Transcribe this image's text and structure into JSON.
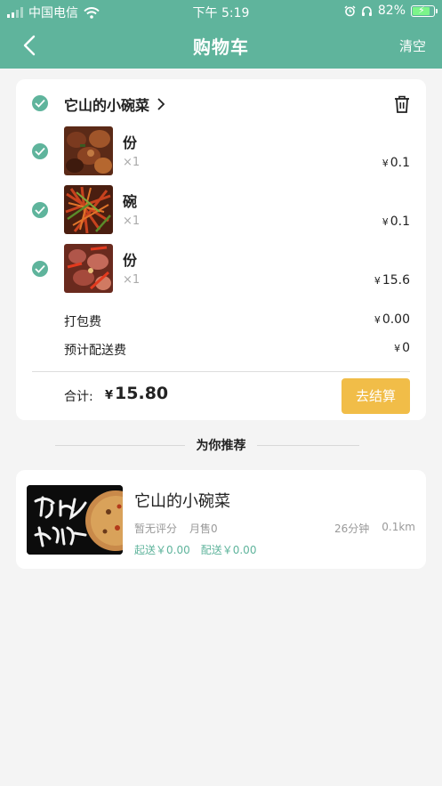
{
  "status_bar": {
    "carrier": "中国电信",
    "time": "下午 5:19",
    "battery_percent": "82%",
    "battery_level": 0.82
  },
  "nav": {
    "back_icon": "chevron-left-icon",
    "title": "购物车",
    "clear_label": "清空"
  },
  "cart": {
    "shop_name": "它山的小碗菜",
    "items": [
      {
        "name": "份",
        "qty": "×1",
        "price": "0.1",
        "image": "braised-meat-dish"
      },
      {
        "name": "碗",
        "qty": "×1",
        "price": "0.1",
        "image": "shredded-stir-fry-dish"
      },
      {
        "name": "份",
        "qty": "×1",
        "price": "15.6",
        "image": "spicy-meat-dish"
      }
    ],
    "packing_fee_label": "打包费",
    "packing_fee_value": "0.00",
    "delivery_fee_label": "预计配送费",
    "delivery_fee_value": "0",
    "total_label": "合计:",
    "total_value": "15.80",
    "checkout_label": "去结算",
    "currency": "¥"
  },
  "recommend": {
    "title": "为你推荐",
    "shop": {
      "name": "它山的小碗菜",
      "rating": "暂无评分",
      "monthly_sales": "月售0",
      "time": "26分钟",
      "distance": "0.1km",
      "min_order": "起送￥0.00",
      "delivery": "配送￥0.00",
      "logo_text": "它山的小碗菜"
    }
  },
  "colors": {
    "brand": "#5fb49c",
    "checkout": "#f1bd48"
  }
}
